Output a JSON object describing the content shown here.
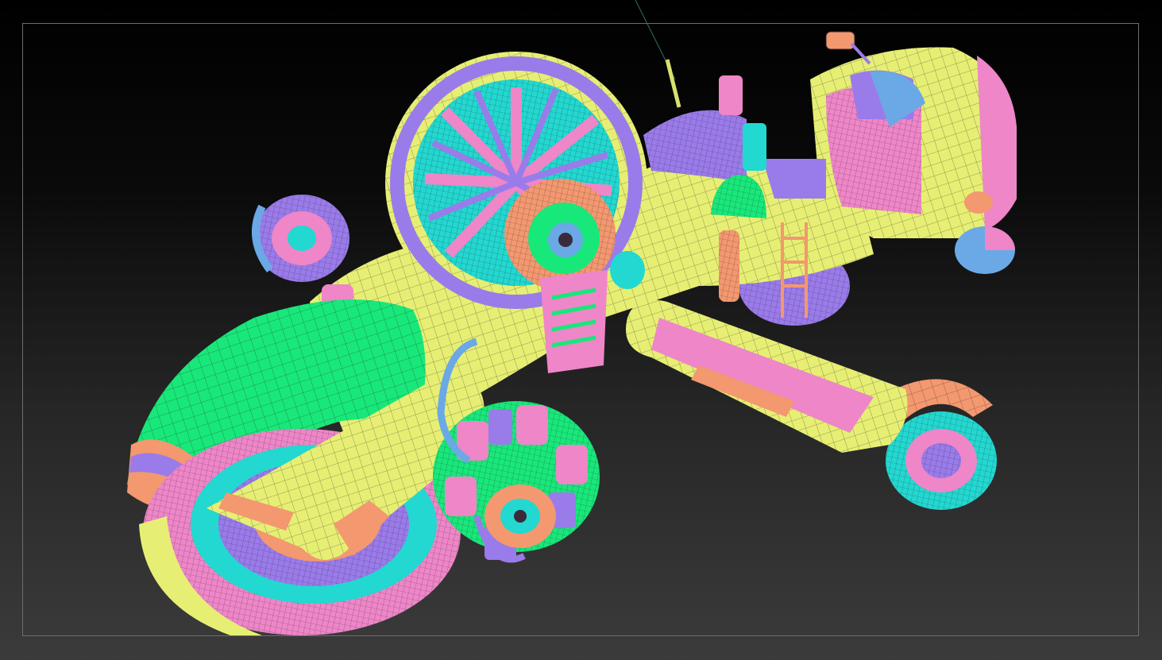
{
  "viewport": {
    "background_top": "#000000",
    "background_bottom": "#3b3b3b",
    "frame_color": "#6e6e6e"
  },
  "model": {
    "name_icon": "polygroup-hovercraft-model",
    "palette": {
      "lime": "#e6ef73",
      "green": "#18e87a",
      "pink": "#ee86c8",
      "purple": "#9a7bea",
      "cyan": "#22d8d0",
      "salmon": "#f3986f",
      "blue": "#6aa9e6",
      "wire": "#3a2a3a"
    }
  }
}
